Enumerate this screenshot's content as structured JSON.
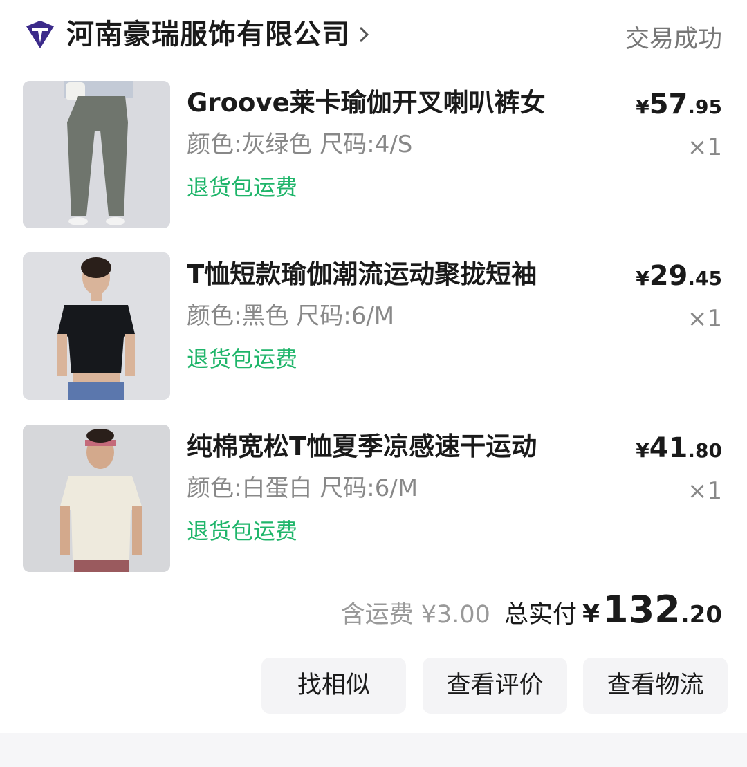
{
  "shop": {
    "name": "河南豪瑞服饰有限公司",
    "logo_icon": "brand-logo-icon",
    "status": "交易成功"
  },
  "items": [
    {
      "title": "Groove莱卡瑜伽开叉喇叭裤女",
      "spec": "颜色:灰绿色 尺码:4/S",
      "return_badge": "退货包运费",
      "price_currency": "¥",
      "price_int": "57",
      "price_dec": ".95",
      "qty": "×1"
    },
    {
      "title": "T恤短款瑜伽潮流运动聚拢短袖",
      "spec": "颜色:黑色 尺码:6/M",
      "return_badge": "退货包运费",
      "price_currency": "¥",
      "price_int": "29",
      "price_dec": ".45",
      "qty": "×1"
    },
    {
      "title": "纯棉宽松T恤夏季凉感速干运动",
      "spec": "颜色:白蛋白 尺码:6/M",
      "return_badge": "退货包运费",
      "price_currency": "¥",
      "price_int": "41",
      "price_dec": ".80",
      "qty": "×1"
    }
  ],
  "summary": {
    "shipping": "含运费 ¥3.00",
    "total_label": "总实付",
    "total_currency": "¥",
    "total_int": "132",
    "total_dec": ".20"
  },
  "actions": {
    "find_similar": "找相似",
    "view_reviews": "查看评价",
    "view_logistics": "查看物流"
  },
  "colors": {
    "return_green": "#1fb56a",
    "muted_gray": "#888888",
    "button_bg": "#f4f4f6"
  }
}
